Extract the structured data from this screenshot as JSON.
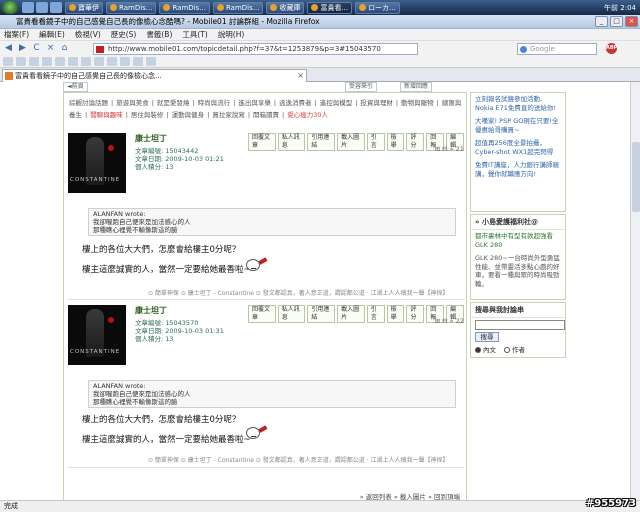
{
  "taskbar": {
    "tasks": [
      "寶華伊",
      "RamDis...",
      "RamDis...",
      "RamDis...",
      "收藏庫",
      "富貴看...",
      "ローカ..."
    ],
    "clock": "午前 2:04"
  },
  "window": {
    "title": "富貴看看鏡子中的自己感覺自己長的像檢心念酷嗎? - Mobile01 討論群組 - Mozilla Firefox",
    "minimize": "_",
    "maximize": "□",
    "close": "×"
  },
  "menu": [
    "檔案(F)",
    "編輯(E)",
    "檢視(V)",
    "歷史(S)",
    "書籤(B)",
    "工具(T)",
    "說明(H)"
  ],
  "nav": {
    "back": "◀",
    "forward": "▶",
    "reload": "C",
    "stop": "×",
    "home": "⌂",
    "url": "http://www.mobile01.com/topicdetail.php?f=37&t=1253879&p=3#15043570",
    "search_placeholder": "Google",
    "abp": "ABP"
  },
  "tab": {
    "title": "富貴看看鏡子中的自己感覺自己長的像檢心念...",
    "close": "×"
  },
  "categories": [
    {
      "label": "綜觀討論話題",
      "style": ""
    },
    {
      "label": "旅遊與美食",
      "style": ""
    },
    {
      "label": "就是愛發燒",
      "style": ""
    },
    {
      "label": "時尚與流行",
      "style": ""
    },
    {
      "label": "進出與享樂",
      "style": ""
    },
    {
      "label": "逃逸消費者",
      "style": ""
    },
    {
      "label": "遙控與模型",
      "style": ""
    },
    {
      "label": "投資與理財",
      "style": ""
    },
    {
      "label": "動物與寵物",
      "style": ""
    },
    {
      "label": "總匯與養生",
      "style": ""
    },
    {
      "label": "閒聊與趣味",
      "style": "sel"
    },
    {
      "label": "居住與裝修",
      "style": ""
    },
    {
      "label": "運動與健身",
      "style": ""
    },
    {
      "label": "買拉家說寫",
      "style": ""
    },
    {
      "label": "開箱讀賣",
      "style": ""
    },
    {
      "label": "愛心瘋力30人",
      "style": "hot"
    }
  ],
  "top_buttons": {
    "left": "◄前頁",
    "mid": "受容來引",
    "right": "新增回應"
  },
  "posts": [
    {
      "author": "康士坦丁",
      "post_id": "文章編號: 15043442",
      "date": "文章日期: 2009-10-03 01:21",
      "points": "個人積分: 13",
      "number": "⊞ ⊟ » 21",
      "avatar_text": "CONSTANTINE",
      "quote_author": "ALANFAN wrote:",
      "quote_line1": "我卻喔跑自己便來是加法感心的人",
      "quote_line2": "那種瞧心裡覺不輸像斯這的臉",
      "line1": "樓上的各位大大們，怎麼會給樓主0分呢？",
      "line2": "樓主這麼誠實的人，當然一定要給她最香啦~",
      "signature": "⊙ 簡單神保 ⊙ 康士坦丁 - Constantine ⊙ 發文都認真，著人意正道，謂認都公道 · 江湖上人人稱我一聲【神探】"
    },
    {
      "author": "康士坦丁",
      "post_id": "文章編號: 15043570",
      "date": "文章日期: 2009-10-03 01:31",
      "points": "個人積分: 13",
      "number": "⊞ ⊟ » 22",
      "avatar_text": "CONSTANTINE",
      "quote_author": "ALANFAN wrote:",
      "quote_line1": "我卻喔跑自己便來是加法感心的人",
      "quote_line2": "那種瞧心裡覺不輸像斯這的臉",
      "line1": "樓上的各位大大們，怎麼會給樓主0分呢？",
      "line2": "樓主這麼誠實的人，當然一定要給她最香啦~",
      "signature": "⊙ 簡單神保 ⊙ 康士坦丁 - Constantine ⊙ 發文都認真，著人意正道，謂認都公道 · 江湖上人人稱我一聲【神探】"
    }
  ],
  "post_actions": [
    "回覆文章",
    "私人訊息",
    "引用連結",
    "載入圖片",
    "引言",
    "檢舉",
    "評分",
    "回報",
    "編輯"
  ],
  "bottom_nav": "» 返回列表 » 載入圖片 » 回到頂端",
  "right_ads": [
    {
      "text": "立刻報名試鏡參加活動, Nokia E71免費直的送給你!",
      "style": ""
    },
    {
      "text": "大嘆家! PSP GO現在只要!全優惠給哥購買~",
      "style": ""
    },
    {
      "text": "超值再256度全景拍攝，Cyber-shot WX1超完閃得",
      "style": ""
    },
    {
      "text": "免費IT講座，人力銀行講師親講，聲你就職應方向!",
      "style": ""
    }
  ],
  "small_panel": {
    "heading": "» 小島愛護福利社@",
    "link": "都市裏林中有型有款超強看GLK 280",
    "desc": "GLK 280~一台時尚外型勇猛性能、並帶靈活多點心戲的好車，要看一種與眾的時尚吸勁輪。"
  },
  "search_panel": {
    "heading": "搜尋與我討論串",
    "button": "搜尋",
    "opt1": "內文",
    "opt2": "作者"
  },
  "status": "完成",
  "watermark": "#955973"
}
